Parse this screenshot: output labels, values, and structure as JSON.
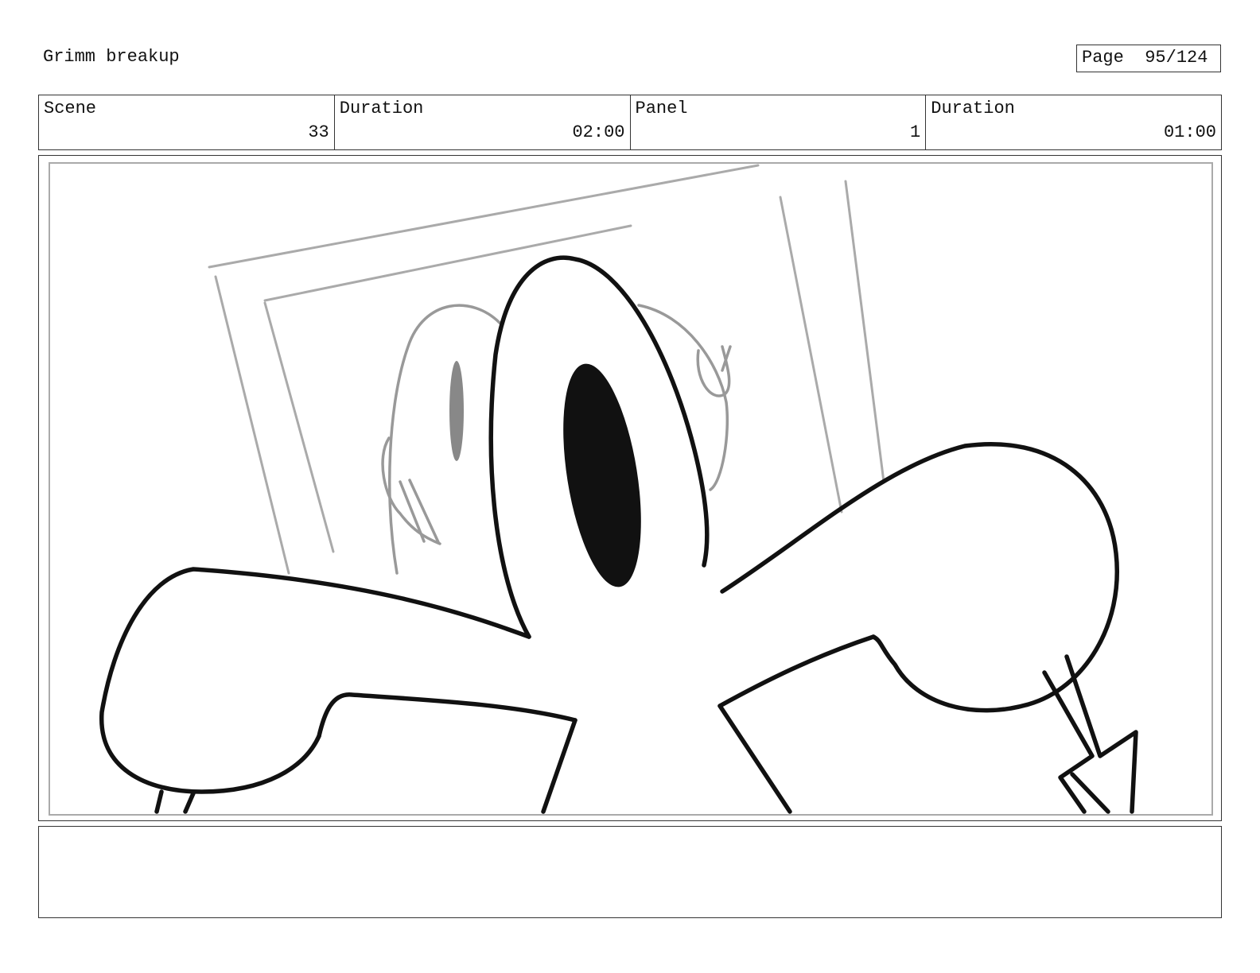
{
  "header": {
    "title": "Grimm breakup",
    "page_label": "Page",
    "page_value": "95/124"
  },
  "info": [
    {
      "label": "Scene",
      "value": "33"
    },
    {
      "label": "Duration",
      "value": "02:00"
    },
    {
      "label": "Panel",
      "value": "1"
    },
    {
      "label": "Duration",
      "value": "01:00"
    }
  ],
  "notes": {
    "text": ""
  }
}
